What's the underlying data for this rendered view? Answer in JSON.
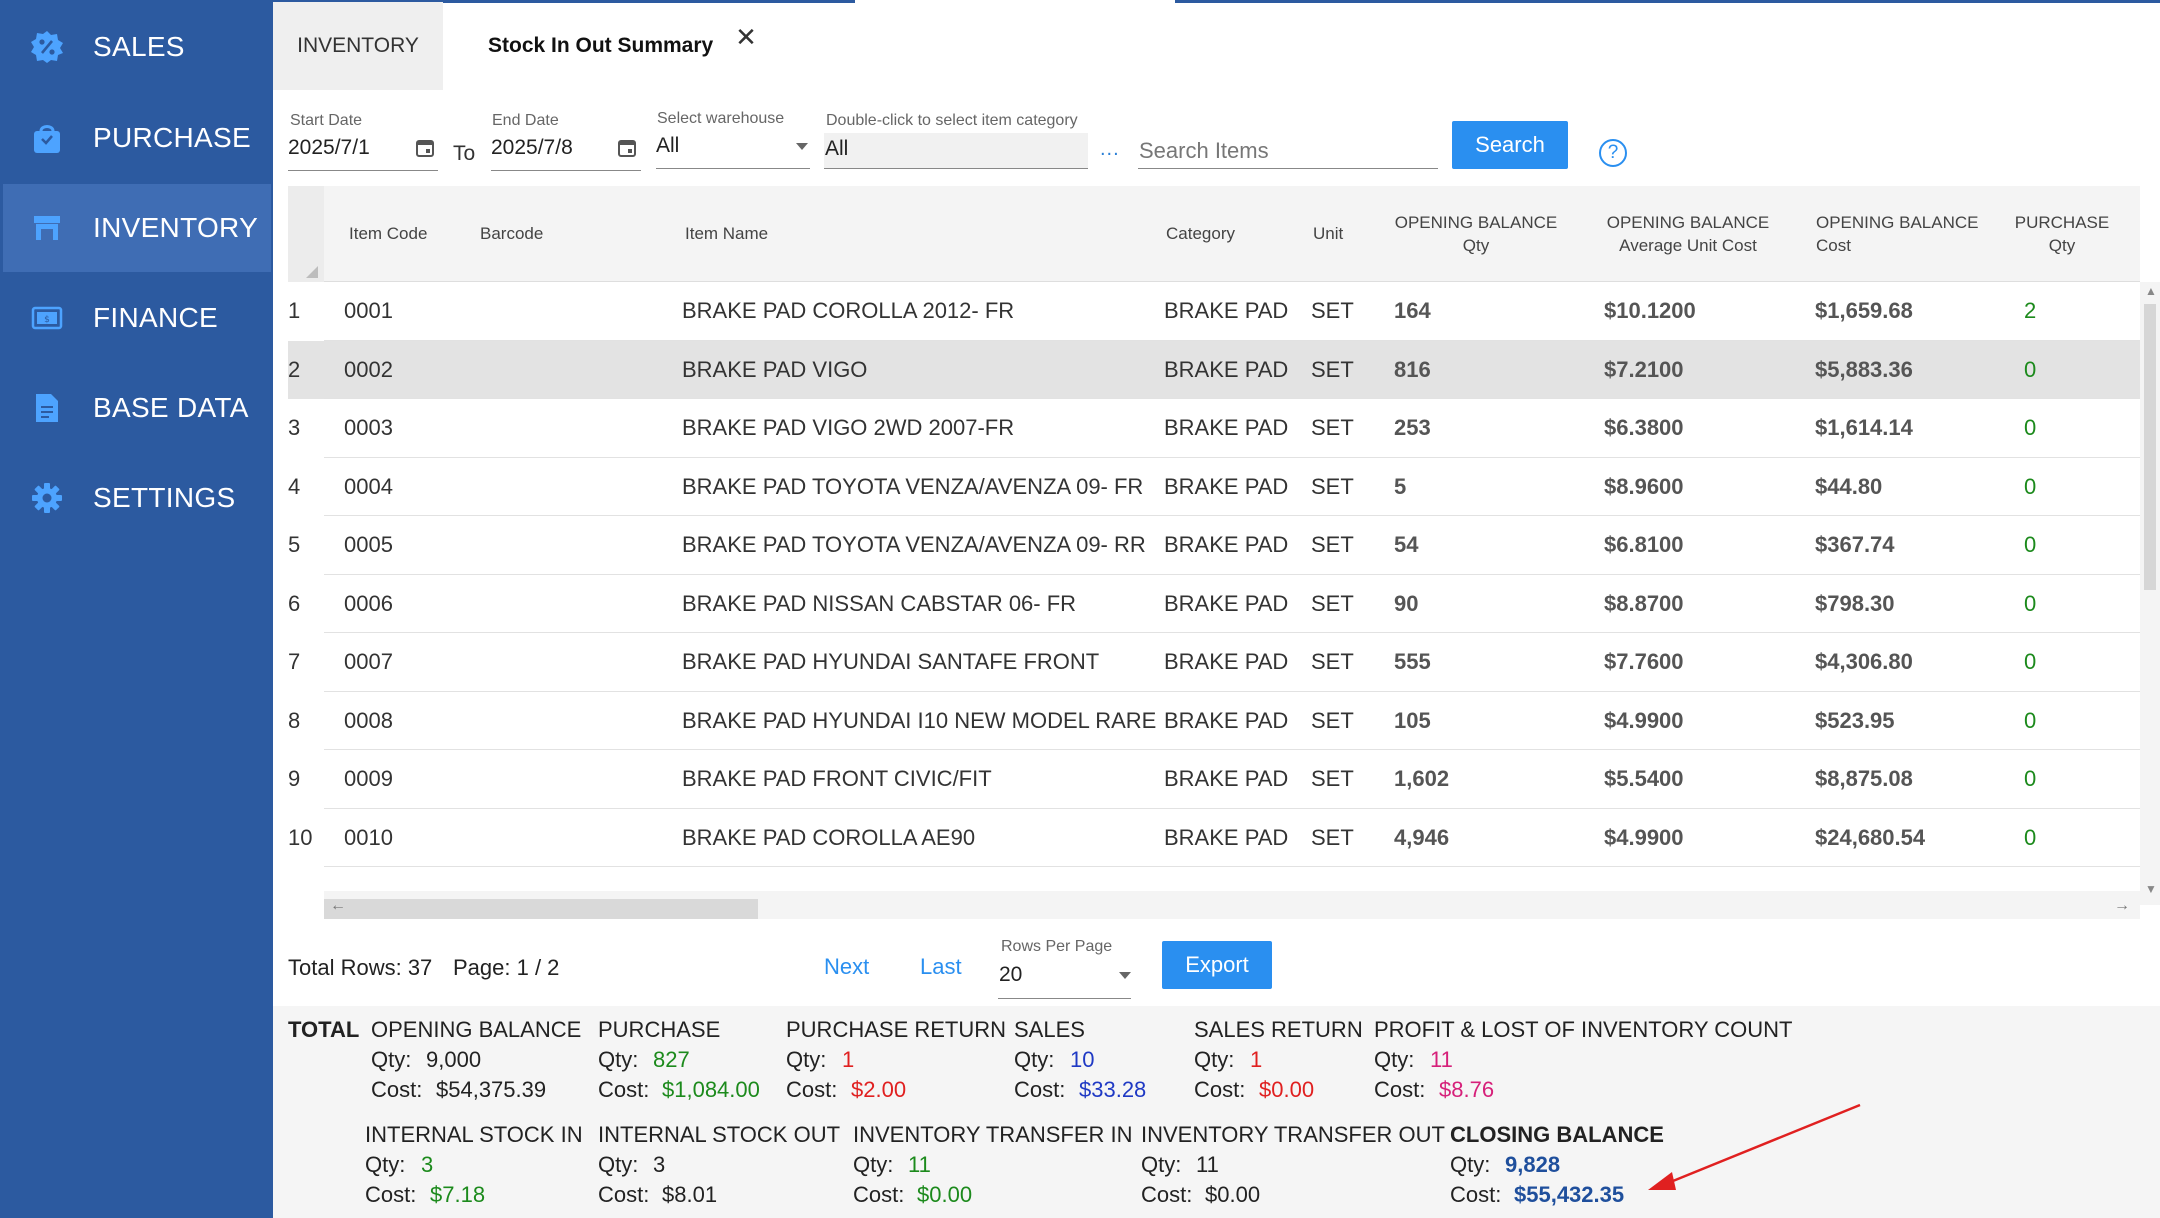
{
  "sidebar": {
    "items": [
      {
        "label": "SALES",
        "icon": "sales-percent-icon"
      },
      {
        "label": "PURCHASE",
        "icon": "shopping-bag-icon"
      },
      {
        "label": "INVENTORY",
        "icon": "store-icon",
        "active": true
      },
      {
        "label": "FINANCE",
        "icon": "money-icon"
      },
      {
        "label": "BASE DATA",
        "icon": "document-icon"
      },
      {
        "label": "SETTINGS",
        "icon": "gear-icon"
      }
    ],
    "bg_color": "#2c5aa0",
    "active_color": "#3f6db4"
  },
  "tabs": {
    "inventory_label": "INVENTORY",
    "active_label": "Stock In Out Summary",
    "close_glyph": "✕"
  },
  "filters": {
    "start_date_label": "Start Date",
    "start_date_value": "2025/7/1",
    "to_label": "To",
    "end_date_label": "End Date",
    "end_date_value": "2025/7/8",
    "warehouse_label": "Select warehouse",
    "warehouse_value": "All",
    "category_label": "Double-click to select item category",
    "category_value": "All",
    "dots": "...",
    "search_placeholder": "Search Items",
    "search_button": "Search",
    "help_glyph": "?"
  },
  "grid": {
    "headers": {
      "item_code": "Item Code",
      "barcode": "Barcode",
      "item_name": "Item Name",
      "category": "Category",
      "unit": "Unit",
      "ob_qty_1": "OPENING BALANCE",
      "ob_qty_2": "Qty",
      "ob_avg_1": "OPENING BALANCE",
      "ob_avg_2": "Average Unit Cost",
      "ob_cost_1": "OPENING BALANCE",
      "ob_cost_2": "Cost",
      "purchase_qty_1": "PURCHASE",
      "purchase_qty_2": "Qty"
    },
    "rows": [
      {
        "n": "1",
        "code": "0001",
        "barcode": "",
        "name": "BRAKE PAD COROLLA 2012- FR",
        "category": "BRAKE PAD",
        "unit": "SET",
        "ob_qty": "164",
        "ob_avg": "$10.1200",
        "ob_cost": "$1,659.68",
        "p_qty": "2"
      },
      {
        "n": "2",
        "code": "0002",
        "barcode": "",
        "name": "BRAKE PAD VIGO",
        "category": "BRAKE PAD",
        "unit": "SET",
        "ob_qty": "816",
        "ob_avg": "$7.2100",
        "ob_cost": "$5,883.36",
        "p_qty": "0"
      },
      {
        "n": "3",
        "code": "0003",
        "barcode": "",
        "name": "BRAKE PAD VIGO 2WD 2007-FR",
        "category": "BRAKE PAD",
        "unit": "SET",
        "ob_qty": "253",
        "ob_avg": "$6.3800",
        "ob_cost": "$1,614.14",
        "p_qty": "0"
      },
      {
        "n": "4",
        "code": "0004",
        "barcode": "",
        "name": "BRAKE PAD TOYOTA VENZA/AVENZA 09- FR",
        "category": "BRAKE PAD",
        "unit": "SET",
        "ob_qty": "5",
        "ob_avg": "$8.9600",
        "ob_cost": "$44.80",
        "p_qty": "0"
      },
      {
        "n": "5",
        "code": "0005",
        "barcode": "",
        "name": "BRAKE PAD TOYOTA VENZA/AVENZA 09- RR",
        "category": "BRAKE PAD",
        "unit": "SET",
        "ob_qty": "54",
        "ob_avg": "$6.8100",
        "ob_cost": "$367.74",
        "p_qty": "0"
      },
      {
        "n": "6",
        "code": "0006",
        "barcode": "",
        "name": "BRAKE PAD NISSAN CABSTAR 06- FR",
        "category": "BRAKE PAD",
        "unit": "SET",
        "ob_qty": "90",
        "ob_avg": "$8.8700",
        "ob_cost": "$798.30",
        "p_qty": "0"
      },
      {
        "n": "7",
        "code": "0007",
        "barcode": "",
        "name": "BRAKE PAD HYUNDAI SANTAFE FRONT",
        "category": "BRAKE PAD",
        "unit": "SET",
        "ob_qty": "555",
        "ob_avg": "$7.7600",
        "ob_cost": "$4,306.80",
        "p_qty": "0"
      },
      {
        "n": "8",
        "code": "0008",
        "barcode": "",
        "name": "BRAKE PAD HYUNDAI I10 NEW MODEL RARE",
        "category": "BRAKE PAD",
        "unit": "SET",
        "ob_qty": "105",
        "ob_avg": "$4.9900",
        "ob_cost": "$523.95",
        "p_qty": "0"
      },
      {
        "n": "9",
        "code": "0009",
        "barcode": "",
        "name": "BRAKE PAD FRONT CIVIC/FIT",
        "category": "BRAKE PAD",
        "unit": "SET",
        "ob_qty": "1,602",
        "ob_avg": "$5.5400",
        "ob_cost": "$8,875.08",
        "p_qty": "0"
      },
      {
        "n": "10",
        "code": "0010",
        "barcode": "",
        "name": "BRAKE PAD COROLLA AE90",
        "category": "BRAKE PAD",
        "unit": "SET",
        "ob_qty": "4,946",
        "ob_avg": "$4.9900",
        "ob_cost": "$24,680.54",
        "p_qty": "0"
      }
    ],
    "selected_row": 2
  },
  "pager": {
    "total_rows_label": "Total Rows: 37",
    "page_label": "Page: 1 / 2",
    "next": "Next",
    "last": "Last",
    "rows_per_page_label": "Rows Per Page",
    "rows_per_page_value": "20",
    "export": "Export"
  },
  "totals": {
    "total_label": "TOTAL",
    "qty_label": "Qty:",
    "cost_label": "Cost:",
    "opening": {
      "title": "OPENING BALANCE",
      "qty": "9,000",
      "cost": "$54,375.39"
    },
    "purchase": {
      "title": "PURCHASE",
      "qty": "827",
      "cost": "$1,084.00"
    },
    "purchase_return": {
      "title": "PURCHASE RETURN",
      "qty": "1",
      "cost": "$2.00"
    },
    "sales": {
      "title": "SALES",
      "qty": "10",
      "cost": "$33.28"
    },
    "sales_return": {
      "title": "SALES RETURN",
      "qty": "1",
      "cost": "$0.00"
    },
    "profit_lost": {
      "title": "PROFIT & LOST OF INVENTORY COUNT",
      "qty": "11",
      "cost": "$8.76"
    },
    "internal_in": {
      "title": "INTERNAL STOCK IN",
      "qty": "3",
      "cost": "$7.18"
    },
    "internal_out": {
      "title": "INTERNAL STOCK OUT",
      "qty": "3",
      "cost": "$8.01"
    },
    "transfer_in": {
      "title": "INVENTORY TRANSFER IN",
      "qty": "11",
      "cost": "$0.00"
    },
    "transfer_out": {
      "title": "INVENTORY TRANSFER OUT",
      "qty": "11",
      "cost": "$0.00"
    },
    "closing": {
      "title": "CLOSING BALANCE",
      "qty": "9,828",
      "cost": "$55,432.35"
    }
  },
  "colors": {
    "primary": "#2a8ff0",
    "green": "#1c8a1c",
    "red": "#e02020",
    "blue": "#1f39c4",
    "pink": "#d6207a",
    "navy": "#1f4f9c",
    "annotation_arrow": "#e02020"
  }
}
